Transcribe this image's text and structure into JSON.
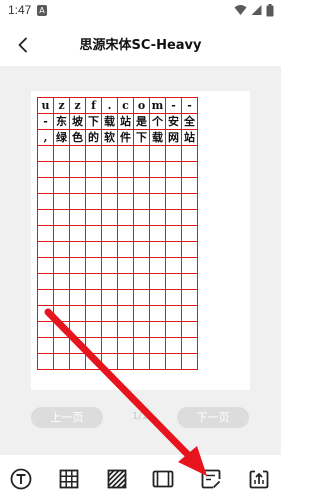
{
  "status_bar": {
    "time": "1:47",
    "notification_icon": "A",
    "icons": [
      "wifi-icon",
      "signal-icon",
      "battery-icon"
    ]
  },
  "header": {
    "title": "思源宋体SC-Heavy",
    "back_icon": "chevron-left-icon"
  },
  "grid": {
    "rows": [
      [
        "u",
        "z",
        "z",
        "f",
        ".",
        "c",
        "o",
        "m",
        "-",
        "-"
      ],
      [
        "-",
        "东",
        "坡",
        "下",
        "载",
        "站",
        "是",
        "个",
        "安",
        "全"
      ],
      [
        ",",
        "绿",
        "色",
        "的",
        "软",
        "件",
        "下",
        "载",
        "网",
        "站"
      ],
      [
        "",
        "",
        "",
        "",
        "",
        "",
        "",
        "",
        "",
        ""
      ],
      [
        "",
        "",
        "",
        "",
        "",
        "",
        "",
        "",
        "",
        ""
      ],
      [
        "",
        "",
        "",
        "",
        "",
        "",
        "",
        "",
        "",
        ""
      ],
      [
        "",
        "",
        "",
        "",
        "",
        "",
        "",
        "",
        "",
        ""
      ],
      [
        "",
        "",
        "",
        "",
        "",
        "",
        "",
        "",
        "",
        ""
      ],
      [
        "",
        "",
        "",
        "",
        "",
        "",
        "",
        "",
        "",
        ""
      ],
      [
        "",
        "",
        "",
        "",
        "",
        "",
        "",
        "",
        "",
        ""
      ],
      [
        "",
        "",
        "",
        "",
        "",
        "",
        "",
        "",
        "",
        ""
      ],
      [
        "",
        "",
        "",
        "",
        "",
        "",
        "",
        "",
        "",
        ""
      ],
      [
        "",
        "",
        "",
        "",
        "",
        "",
        "",
        "",
        "",
        ""
      ],
      [
        "",
        "",
        "",
        "",
        "",
        "",
        "",
        "",
        "",
        ""
      ],
      [
        "",
        "",
        "",
        "",
        "",
        "",
        "",
        "",
        "",
        ""
      ],
      [
        "",
        "",
        "",
        "",
        "",
        "",
        "",
        "",
        "",
        ""
      ],
      [
        "",
        "",
        "",
        "",
        "",
        "",
        "",
        "",
        "",
        ""
      ]
    ],
    "grid_color": "#d81b1b"
  },
  "pager": {
    "prev_label": "上一页",
    "next_label": "下一页",
    "page_indicator": "1/1"
  },
  "toolbar": {
    "items": [
      "text-style-icon",
      "grid-style-icon",
      "hatch-pattern-icon",
      "paper-frame-icon",
      "edit-note-icon",
      "export-icon"
    ]
  },
  "colors": {
    "accent": "#e8141d",
    "button_disabled": "#dcdcdc"
  }
}
